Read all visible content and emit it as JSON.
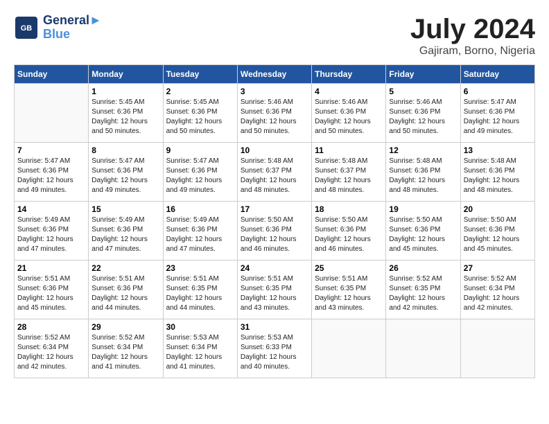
{
  "header": {
    "logo_general": "General",
    "logo_blue": "Blue",
    "month_year": "July 2024",
    "location": "Gajiram, Borno, Nigeria"
  },
  "columns": [
    "Sunday",
    "Monday",
    "Tuesday",
    "Wednesday",
    "Thursday",
    "Friday",
    "Saturday"
  ],
  "weeks": [
    [
      {
        "day": "",
        "sunrise": "",
        "sunset": "",
        "daylight": ""
      },
      {
        "day": "1",
        "sunrise": "Sunrise: 5:45 AM",
        "sunset": "Sunset: 6:36 PM",
        "daylight": "Daylight: 12 hours and 50 minutes."
      },
      {
        "day": "2",
        "sunrise": "Sunrise: 5:45 AM",
        "sunset": "Sunset: 6:36 PM",
        "daylight": "Daylight: 12 hours and 50 minutes."
      },
      {
        "day": "3",
        "sunrise": "Sunrise: 5:46 AM",
        "sunset": "Sunset: 6:36 PM",
        "daylight": "Daylight: 12 hours and 50 minutes."
      },
      {
        "day": "4",
        "sunrise": "Sunrise: 5:46 AM",
        "sunset": "Sunset: 6:36 PM",
        "daylight": "Daylight: 12 hours and 50 minutes."
      },
      {
        "day": "5",
        "sunrise": "Sunrise: 5:46 AM",
        "sunset": "Sunset: 6:36 PM",
        "daylight": "Daylight: 12 hours and 50 minutes."
      },
      {
        "day": "6",
        "sunrise": "Sunrise: 5:47 AM",
        "sunset": "Sunset: 6:36 PM",
        "daylight": "Daylight: 12 hours and 49 minutes."
      }
    ],
    [
      {
        "day": "7",
        "sunrise": "Sunrise: 5:47 AM",
        "sunset": "Sunset: 6:36 PM",
        "daylight": "Daylight: 12 hours and 49 minutes."
      },
      {
        "day": "8",
        "sunrise": "Sunrise: 5:47 AM",
        "sunset": "Sunset: 6:36 PM",
        "daylight": "Daylight: 12 hours and 49 minutes."
      },
      {
        "day": "9",
        "sunrise": "Sunrise: 5:47 AM",
        "sunset": "Sunset: 6:36 PM",
        "daylight": "Daylight: 12 hours and 49 minutes."
      },
      {
        "day": "10",
        "sunrise": "Sunrise: 5:48 AM",
        "sunset": "Sunset: 6:37 PM",
        "daylight": "Daylight: 12 hours and 48 minutes."
      },
      {
        "day": "11",
        "sunrise": "Sunrise: 5:48 AM",
        "sunset": "Sunset: 6:37 PM",
        "daylight": "Daylight: 12 hours and 48 minutes."
      },
      {
        "day": "12",
        "sunrise": "Sunrise: 5:48 AM",
        "sunset": "Sunset: 6:36 PM",
        "daylight": "Daylight: 12 hours and 48 minutes."
      },
      {
        "day": "13",
        "sunrise": "Sunrise: 5:48 AM",
        "sunset": "Sunset: 6:36 PM",
        "daylight": "Daylight: 12 hours and 48 minutes."
      }
    ],
    [
      {
        "day": "14",
        "sunrise": "Sunrise: 5:49 AM",
        "sunset": "Sunset: 6:36 PM",
        "daylight": "Daylight: 12 hours and 47 minutes."
      },
      {
        "day": "15",
        "sunrise": "Sunrise: 5:49 AM",
        "sunset": "Sunset: 6:36 PM",
        "daylight": "Daylight: 12 hours and 47 minutes."
      },
      {
        "day": "16",
        "sunrise": "Sunrise: 5:49 AM",
        "sunset": "Sunset: 6:36 PM",
        "daylight": "Daylight: 12 hours and 47 minutes."
      },
      {
        "day": "17",
        "sunrise": "Sunrise: 5:50 AM",
        "sunset": "Sunset: 6:36 PM",
        "daylight": "Daylight: 12 hours and 46 minutes."
      },
      {
        "day": "18",
        "sunrise": "Sunrise: 5:50 AM",
        "sunset": "Sunset: 6:36 PM",
        "daylight": "Daylight: 12 hours and 46 minutes."
      },
      {
        "day": "19",
        "sunrise": "Sunrise: 5:50 AM",
        "sunset": "Sunset: 6:36 PM",
        "daylight": "Daylight: 12 hours and 45 minutes."
      },
      {
        "day": "20",
        "sunrise": "Sunrise: 5:50 AM",
        "sunset": "Sunset: 6:36 PM",
        "daylight": "Daylight: 12 hours and 45 minutes."
      }
    ],
    [
      {
        "day": "21",
        "sunrise": "Sunrise: 5:51 AM",
        "sunset": "Sunset: 6:36 PM",
        "daylight": "Daylight: 12 hours and 45 minutes."
      },
      {
        "day": "22",
        "sunrise": "Sunrise: 5:51 AM",
        "sunset": "Sunset: 6:36 PM",
        "daylight": "Daylight: 12 hours and 44 minutes."
      },
      {
        "day": "23",
        "sunrise": "Sunrise: 5:51 AM",
        "sunset": "Sunset: 6:35 PM",
        "daylight": "Daylight: 12 hours and 44 minutes."
      },
      {
        "day": "24",
        "sunrise": "Sunrise: 5:51 AM",
        "sunset": "Sunset: 6:35 PM",
        "daylight": "Daylight: 12 hours and 43 minutes."
      },
      {
        "day": "25",
        "sunrise": "Sunrise: 5:51 AM",
        "sunset": "Sunset: 6:35 PM",
        "daylight": "Daylight: 12 hours and 43 minutes."
      },
      {
        "day": "26",
        "sunrise": "Sunrise: 5:52 AM",
        "sunset": "Sunset: 6:35 PM",
        "daylight": "Daylight: 12 hours and 42 minutes."
      },
      {
        "day": "27",
        "sunrise": "Sunrise: 5:52 AM",
        "sunset": "Sunset: 6:34 PM",
        "daylight": "Daylight: 12 hours and 42 minutes."
      }
    ],
    [
      {
        "day": "28",
        "sunrise": "Sunrise: 5:52 AM",
        "sunset": "Sunset: 6:34 PM",
        "daylight": "Daylight: 12 hours and 42 minutes."
      },
      {
        "day": "29",
        "sunrise": "Sunrise: 5:52 AM",
        "sunset": "Sunset: 6:34 PM",
        "daylight": "Daylight: 12 hours and 41 minutes."
      },
      {
        "day": "30",
        "sunrise": "Sunrise: 5:53 AM",
        "sunset": "Sunset: 6:34 PM",
        "daylight": "Daylight: 12 hours and 41 minutes."
      },
      {
        "day": "31",
        "sunrise": "Sunrise: 5:53 AM",
        "sunset": "Sunset: 6:33 PM",
        "daylight": "Daylight: 12 hours and 40 minutes."
      },
      {
        "day": "",
        "sunrise": "",
        "sunset": "",
        "daylight": ""
      },
      {
        "day": "",
        "sunrise": "",
        "sunset": "",
        "daylight": ""
      },
      {
        "day": "",
        "sunrise": "",
        "sunset": "",
        "daylight": ""
      }
    ]
  ]
}
